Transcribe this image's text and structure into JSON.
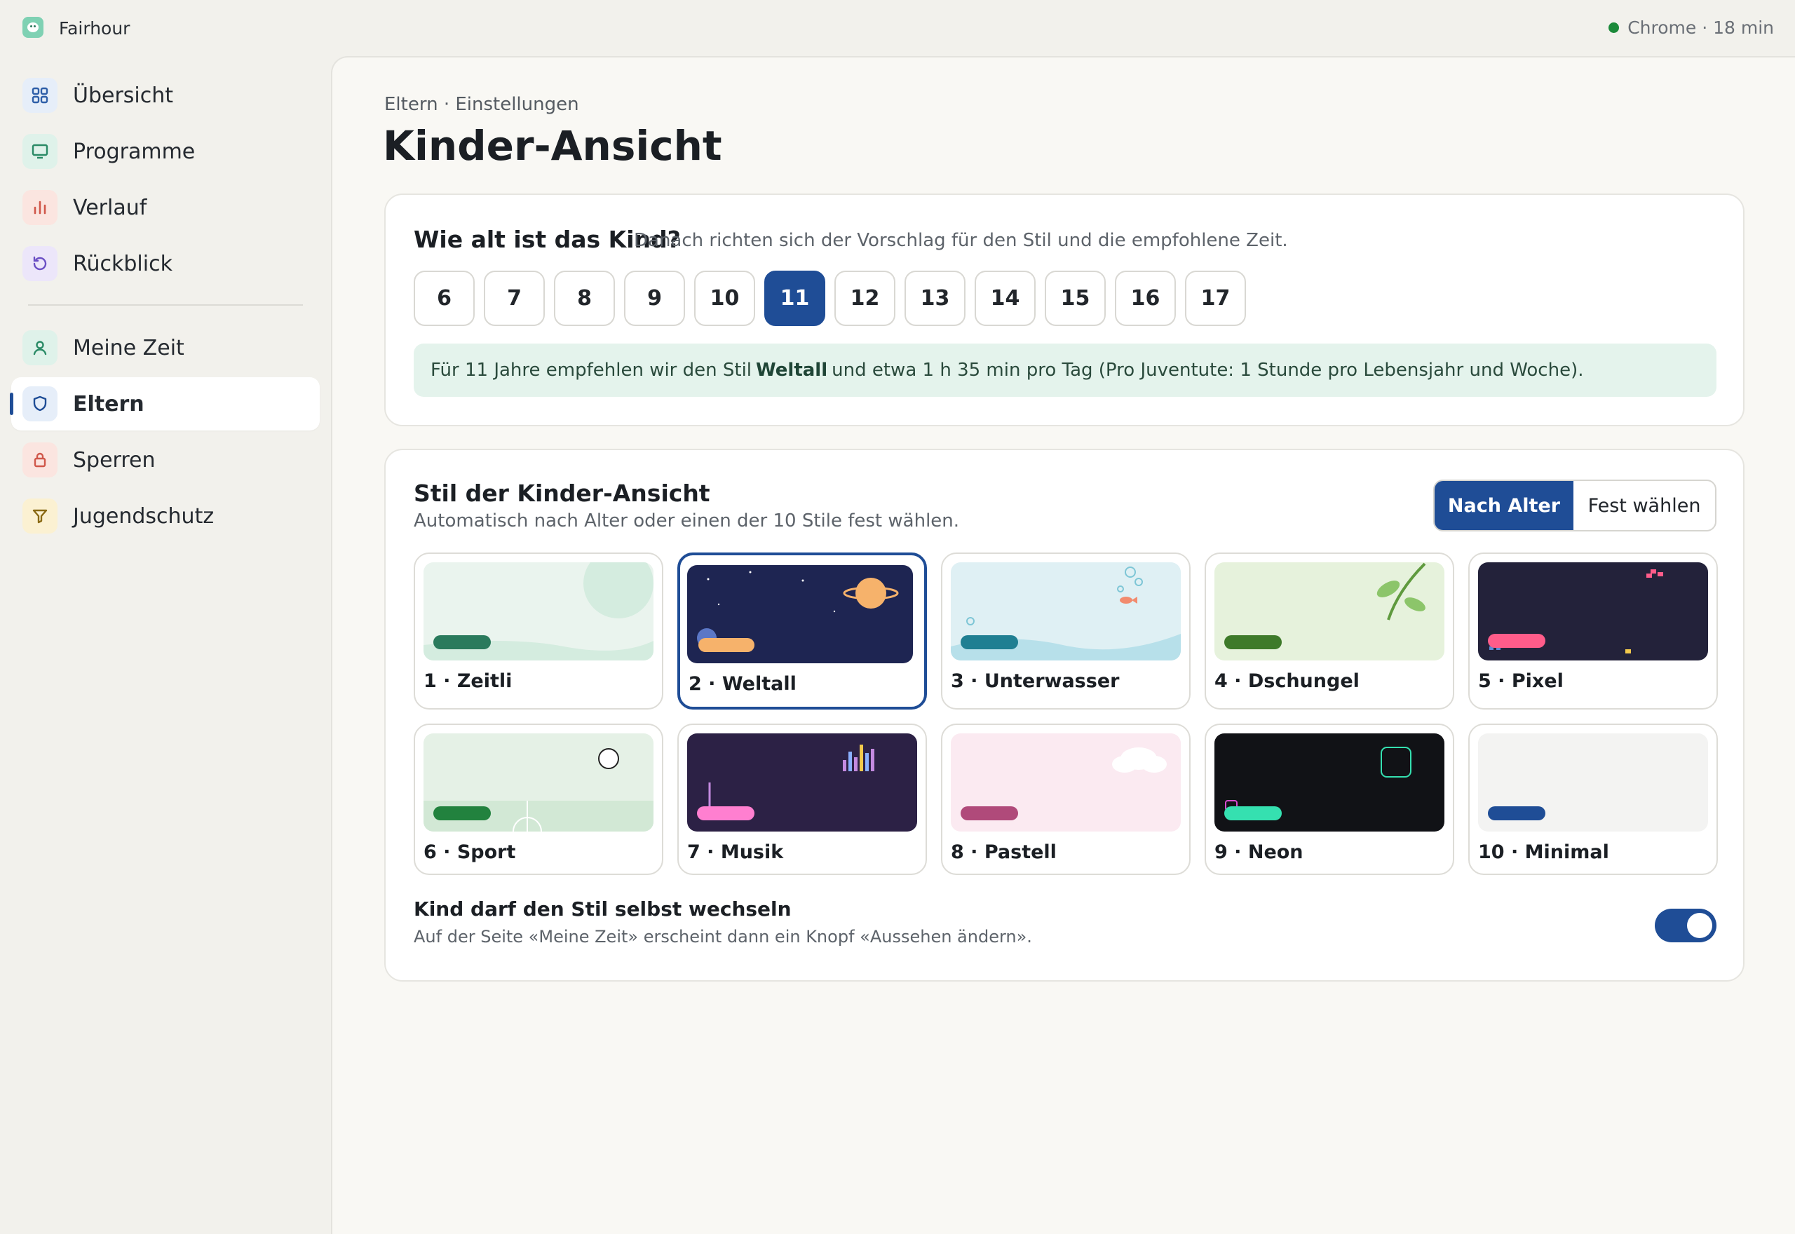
{
  "app": {
    "name": "Fairhour"
  },
  "status": {
    "text": "Chrome · 18 min"
  },
  "sidebar": {
    "items": [
      {
        "label": "Übersicht",
        "icon": "grid-icon",
        "bg": "#e6eef9",
        "color": "#2f5fa8"
      },
      {
        "label": "Programme",
        "icon": "monitor-icon",
        "bg": "#dff2ea",
        "color": "#2a8a66"
      },
      {
        "label": "Verlauf",
        "icon": "bar-chart-icon",
        "bg": "#fbe5e0",
        "color": "#d0574a"
      },
      {
        "label": "Rückblick",
        "icon": "history-icon",
        "bg": "#ece6fa",
        "color": "#6a4fc4"
      }
    ],
    "items2": [
      {
        "label": "Meine Zeit",
        "icon": "person-icon",
        "bg": "#dff2ea",
        "color": "#2a8a66"
      },
      {
        "label": "Eltern",
        "icon": "shield-icon",
        "bg": "#e6eef9",
        "color": "#1f4d96",
        "active": true
      },
      {
        "label": "Sperren",
        "icon": "lock-icon",
        "bg": "#fbe5e0",
        "color": "#d0574a"
      },
      {
        "label": "Jugendschutz",
        "icon": "filter-icon",
        "bg": "#fbf1d2",
        "color": "#8a6a14"
      }
    ]
  },
  "main": {
    "breadcrumb": "Eltern · Einstellungen",
    "title": "Kinder-Ansicht"
  },
  "age": {
    "question": "Wie alt ist das Kind?",
    "hint": "Danach richten sich der Vorschlag für den Stil und die empfohlene Zeit.",
    "options": [
      "6",
      "7",
      "8",
      "9",
      "10",
      "11",
      "12",
      "13",
      "14",
      "15",
      "16",
      "17"
    ],
    "selected": "11",
    "reco_before": "Für 11 Jahre empfehlen wir den Stil",
    "reco_style": "Weltall",
    "reco_after": "und etwa 1 h 35 min pro Tag (Pro Juventute: 1 Stunde pro Lebensjahr und Woche)."
  },
  "style": {
    "title": "Stil der Kinder-Ansicht",
    "subtitle": "Automatisch nach Alter oder einen der 10 Stile fest wählen.",
    "mode_auto": "Nach Alter",
    "mode_fixed": "Fest wählen",
    "tiles": [
      {
        "label": "1 · Zeitli",
        "bg": "#eaf4ee",
        "accent": "#2a7a5c"
      },
      {
        "label": "2 · Weltall",
        "bg": "#1e2552",
        "accent": "#f6b26b",
        "selected": true
      },
      {
        "label": "3 · Unterwasser",
        "bg": "#dff0f4",
        "accent": "#1f7f92"
      },
      {
        "label": "4 · Dschungel",
        "bg": "#e6f2dc",
        "accent": "#3e7a2a"
      },
      {
        "label": "5 · Pixel",
        "bg": "#23223a",
        "accent": "#ff5c8a"
      },
      {
        "label": "6 · Sport",
        "bg": "#e5f1e6",
        "accent": "#22823e"
      },
      {
        "label": "7 · Musik",
        "bg": "#2c2145",
        "accent": "#ff7fd0"
      },
      {
        "label": "8 · Pastell",
        "bg": "#fbeaf1",
        "accent": "#b04a7a"
      },
      {
        "label": "9 · Neon",
        "bg": "#111216",
        "accent": "#35e0b0"
      },
      {
        "label": "10 · Minimal",
        "bg": "#f3f3f2",
        "accent": "#1f4d96"
      }
    ],
    "toggle_title": "Kind darf den Stil selbst wechseln",
    "toggle_sub": "Auf der Seite «Meine Zeit» erscheint dann ein Knopf «Aussehen ändern».",
    "toggle_on": true
  }
}
